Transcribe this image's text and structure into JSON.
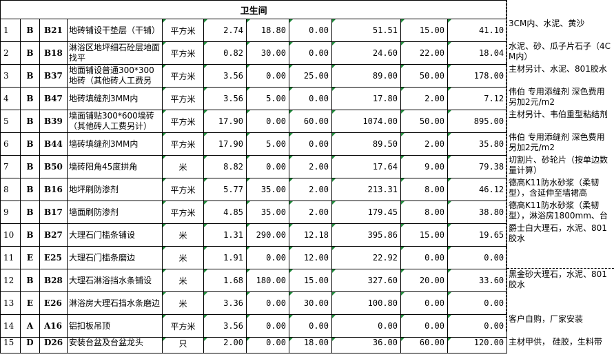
{
  "section_title": "卫生间",
  "rows": [
    {
      "no": "1",
      "group": "B",
      "code": "B21",
      "name": "地砖铺设干垫层（干铺）",
      "unit": "平方米",
      "qty": "2.74",
      "c1": "18.80",
      "c2": "0.00",
      "c3": "51.51",
      "c4": "15.00",
      "c5": "41.10",
      "remark": "3CM内、水泥、黄沙"
    },
    {
      "no": "2",
      "group": "B",
      "code": "B18",
      "name": "淋浴区地坪细石砼层地面找平",
      "unit": "平方米",
      "qty": "0.82",
      "c1": "30.00",
      "c2": "0.00",
      "c3": "24.60",
      "c4": "22.00",
      "c5": "18.04",
      "remark": "水泥、砂、瓜子片石子（4CM内）"
    },
    {
      "no": "3",
      "group": "B",
      "code": "B37",
      "name": "地面铺设普通300*300地砖（其他砖人工费另",
      "unit": "平方米",
      "qty": "3.56",
      "c1": "0.00",
      "c2": "25.00",
      "c3": "89.00",
      "c4": "50.00",
      "c5": "178.00",
      "remark": "主材另计、水泥、801胶水"
    },
    {
      "no": "4",
      "group": "B",
      "code": "B47",
      "name": "地砖填缝剂3MM内",
      "unit": "平方米",
      "qty": "3.56",
      "c1": "5.00",
      "c2": "0.00",
      "c3": "17.80",
      "c4": "2.00",
      "c5": "7.12",
      "remark": "伟伯 专用添缝剂 深色费用另加2元/m2"
    },
    {
      "no": "5",
      "group": "B",
      "code": "B39",
      "name": "墙面铺贴300*600墙砖（其他砖人工费另计）",
      "unit": "平方米",
      "qty": "17.90",
      "c1": "0.00",
      "c2": "60.00",
      "c3": "1074.00",
      "c4": "50.00",
      "c5": "895.00",
      "remark": "主材另计、韦伯重型粘结剂"
    },
    {
      "no": "6",
      "group": "B",
      "code": "B44",
      "name": "墙砖填缝剂3MM内",
      "unit": "平方米",
      "qty": "17.90",
      "c1": "5.00",
      "c2": "0.00",
      "c3": "89.50",
      "c4": "2.00",
      "c5": "35.80",
      "remark": "伟伯 专用添缝剂 深色费用另加2元/m2"
    },
    {
      "no": "7",
      "group": "B",
      "code": "B50",
      "name": "墙砖阳角45度拼角",
      "unit": "米",
      "qty": "8.82",
      "c1": "0.00",
      "c2": "2.00",
      "c3": "17.64",
      "c4": "9.00",
      "c5": "79.38",
      "remark": "切割片、砂轮片（按单边数量计算）"
    },
    {
      "no": "8",
      "group": "B",
      "code": "B16",
      "name": "地坪刷防渗剂",
      "unit": "平方米",
      "qty": "5.77",
      "c1": "35.00",
      "c2": "2.00",
      "c3": "213.31",
      "c4": "8.00",
      "c5": "46.12",
      "remark": "德高K11防水砂浆（柔韧型），含延伸至墙裙高"
    },
    {
      "no": "9",
      "group": "B",
      "code": "B17",
      "name": "墙面刷防渗剂",
      "unit": "平方米",
      "qty": "4.85",
      "c1": "35.00",
      "c2": "2.00",
      "c3": "179.45",
      "c4": "8.00",
      "c5": "38.80",
      "remark": "德高K11防水砂浆（柔韧型），淋浴房1800mm、台"
    },
    {
      "no": "10",
      "group": "B",
      "code": "B27",
      "name": "大理石门槛条铺设",
      "unit": "米",
      "qty": "1.31",
      "c1": "290.00",
      "c2": "12.18",
      "c3": "395.86",
      "c4": "15.00",
      "c5": "19.65",
      "remark": "爵士白大理石，水泥、801胶水"
    },
    {
      "no": "11",
      "group": "E",
      "code": "E25",
      "name": "大理石门槛条磨边",
      "unit": "米",
      "qty": "1.91",
      "c1": "0.00",
      "c2": "12.00",
      "c3": "22.92",
      "c4": "0.00",
      "c5": "0.00",
      "remark": ""
    },
    {
      "no": "12",
      "group": "B",
      "code": "B28",
      "name": "大理石淋浴挡水条铺设",
      "unit": "米",
      "qty": "1.68",
      "c1": "180.00",
      "c2": "15.00",
      "c3": "327.60",
      "c4": "20.00",
      "c5": "33.60",
      "remark": "黑金砂大理石，水泥、801胶水"
    },
    {
      "no": "13",
      "group": "E",
      "code": "E26",
      "name": "淋浴房大理石挡水条磨边",
      "unit": "米",
      "qty": "3.36",
      "c1": "0.00",
      "c2": "30.00",
      "c3": "100.80",
      "c4": "0.00",
      "c5": "0.00",
      "remark": ""
    },
    {
      "no": "14",
      "group": "A",
      "code": "A16",
      "name": "铝扣板吊顶",
      "unit": "平方米",
      "qty": "3.56",
      "c1": "0.00",
      "c2": "0.00",
      "c3": "0.00",
      "c4": "0.00",
      "c5": "0.00",
      "remark": "客户自购，厂家安装"
    },
    {
      "no": "15",
      "group": "D",
      "code": "D26",
      "name": "安装台盆及台盆龙头",
      "unit": "只",
      "qty": "2.00",
      "c1": "0.00",
      "c2": "18.00",
      "c3": "36.00",
      "c4": "60.00",
      "c5": "120.00",
      "remark": "主材甲供， 硅胶，生料带"
    }
  ]
}
